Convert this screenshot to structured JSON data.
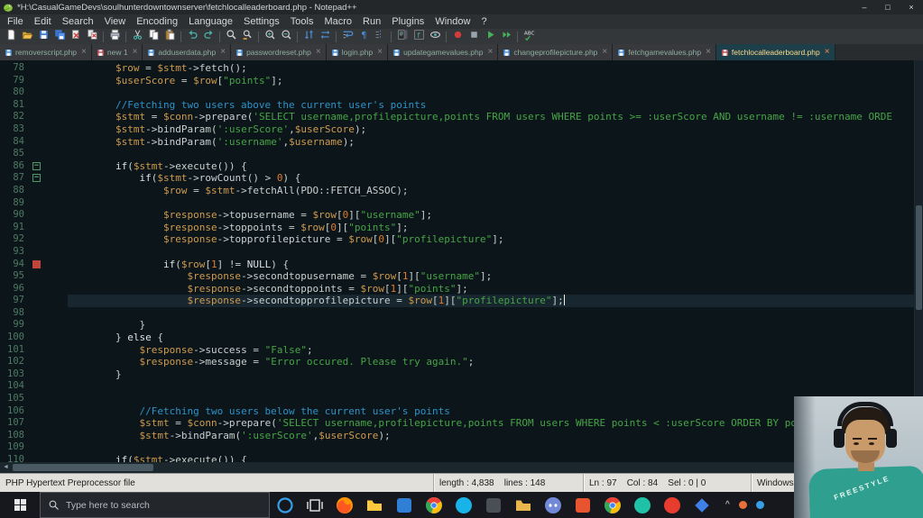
{
  "theme": {
    "titlebar_bg": "#24272a",
    "editor_bg": "#0c151a",
    "current_line_bg": "#17262f",
    "variable_color": "#cf9b4f",
    "string_color": "#46a546",
    "comment_color": "#2c93c8",
    "number_color": "#df7c2e",
    "line_number_color": "#4e7a63",
    "active_tab_text": "#ffd98c",
    "statusbar_bg": "#e2e0db",
    "taskbar_bg": "#16181d",
    "shirt_color": "#2fa090"
  },
  "window": {
    "title": "*H:\\CasualGameDevs\\soulhunterdowntownserver\\fetchlocalleaderboard.php - Notepad++",
    "minimize_glyph": "–",
    "maximize_glyph": "□",
    "close_glyph": "×"
  },
  "menu": {
    "items": [
      "File",
      "Edit",
      "Search",
      "View",
      "Encoding",
      "Language",
      "Settings",
      "Tools",
      "Macro",
      "Run",
      "Plugins",
      "Window",
      "?"
    ]
  },
  "toolbar": {
    "buttons": [
      "new-file",
      "open-file",
      "save",
      "save-all",
      "close",
      "close-all",
      "|",
      "print",
      "|",
      "cut",
      "copy",
      "paste",
      "|",
      "undo",
      "redo",
      "|",
      "find",
      "replace",
      "|",
      "zoom-in",
      "zoom-out",
      "|",
      "sync-vertical",
      "sync-horizontal",
      "|",
      "word-wrap",
      "show-all-characters",
      "indent-guide",
      "|",
      "document-map",
      "function-list",
      "monitoring",
      "|",
      "macro-record",
      "macro-stop",
      "macro-playback",
      "macro-run-multiple",
      "|",
      "spell-check"
    ]
  },
  "tabs": [
    {
      "label": "removerscript.php",
      "modified": false,
      "active": false
    },
    {
      "label": "new 1",
      "modified": true,
      "active": false
    },
    {
      "label": "adduserdata.php",
      "modified": false,
      "active": false
    },
    {
      "label": "passwordreset.php",
      "modified": false,
      "active": false
    },
    {
      "label": "login.php",
      "modified": false,
      "active": false
    },
    {
      "label": "updategamevalues.php",
      "modified": false,
      "active": false
    },
    {
      "label": "changeprofilepicture.php",
      "modified": false,
      "active": false
    },
    {
      "label": "fetchgamevalues.php",
      "modified": false,
      "active": false
    },
    {
      "label": "fetchlocalleaderboard.php",
      "modified": true,
      "active": true
    }
  ],
  "editor": {
    "current_line": 97,
    "caret_col": 84,
    "lines": [
      {
        "n": 78,
        "i": 8,
        "s": [
          [
            "var",
            "$row"
          ],
          [
            "pl",
            " = "
          ],
          [
            "var",
            "$stmt"
          ],
          [
            "pl",
            "->fetch();"
          ]
        ]
      },
      {
        "n": 79,
        "i": 8,
        "s": [
          [
            "var",
            "$userScore"
          ],
          [
            "pl",
            " = "
          ],
          [
            "var",
            "$row"
          ],
          [
            "pl",
            "["
          ],
          [
            "str",
            "\"points\""
          ],
          [
            "pl",
            "];"
          ]
        ]
      },
      {
        "n": 80,
        "i": 0,
        "s": []
      },
      {
        "n": 81,
        "i": 8,
        "s": [
          [
            "com",
            "//Fetching two users above the current user's points"
          ]
        ]
      },
      {
        "n": 82,
        "i": 8,
        "s": [
          [
            "var",
            "$stmt"
          ],
          [
            "pl",
            " = "
          ],
          [
            "var",
            "$conn"
          ],
          [
            "pl",
            "->prepare("
          ],
          [
            "str",
            "'SELECT username,profilepicture,points FROM users WHERE points >= :userScore AND username != :username ORDE"
          ]
        ]
      },
      {
        "n": 83,
        "i": 8,
        "s": [
          [
            "var",
            "$stmt"
          ],
          [
            "pl",
            "->bindParam("
          ],
          [
            "str",
            "':userScore'"
          ],
          [
            "pl",
            ","
          ],
          [
            "var",
            "$userScore"
          ],
          [
            "pl",
            ");"
          ]
        ]
      },
      {
        "n": 84,
        "i": 8,
        "s": [
          [
            "var",
            "$stmt"
          ],
          [
            "pl",
            "->bindParam("
          ],
          [
            "str",
            "':username'"
          ],
          [
            "pl",
            ","
          ],
          [
            "var",
            "$username"
          ],
          [
            "pl",
            ");"
          ]
        ]
      },
      {
        "n": 85,
        "i": 0,
        "s": []
      },
      {
        "n": 86,
        "i": 8,
        "m": "fold",
        "s": [
          [
            "kw",
            "if"
          ],
          [
            "pl",
            "("
          ],
          [
            "var",
            "$stmt"
          ],
          [
            "pl",
            "->execute()) {"
          ]
        ]
      },
      {
        "n": 87,
        "i": 12,
        "m": "fold",
        "s": [
          [
            "kw",
            "if"
          ],
          [
            "pl",
            "("
          ],
          [
            "var",
            "$stmt"
          ],
          [
            "pl",
            "->rowCount() > "
          ],
          [
            "num",
            "0"
          ],
          [
            "pl",
            ") {"
          ]
        ]
      },
      {
        "n": 88,
        "i": 16,
        "s": [
          [
            "var",
            "$row"
          ],
          [
            "pl",
            " = "
          ],
          [
            "var",
            "$stmt"
          ],
          [
            "pl",
            "->fetchAll(PDO::FETCH_ASSOC);"
          ]
        ]
      },
      {
        "n": 89,
        "i": 0,
        "s": []
      },
      {
        "n": 90,
        "i": 16,
        "s": [
          [
            "var",
            "$response"
          ],
          [
            "pl",
            "->topusername = "
          ],
          [
            "var",
            "$row"
          ],
          [
            "pl",
            "["
          ],
          [
            "num",
            "0"
          ],
          [
            "pl",
            "]["
          ],
          [
            "str",
            "\"username\""
          ],
          [
            "pl",
            "];"
          ]
        ]
      },
      {
        "n": 91,
        "i": 16,
        "s": [
          [
            "var",
            "$response"
          ],
          [
            "pl",
            "->toppoints = "
          ],
          [
            "var",
            "$row"
          ],
          [
            "pl",
            "["
          ],
          [
            "num",
            "0"
          ],
          [
            "pl",
            "]["
          ],
          [
            "str",
            "\"points\""
          ],
          [
            "pl",
            "];"
          ]
        ]
      },
      {
        "n": 92,
        "i": 16,
        "s": [
          [
            "var",
            "$response"
          ],
          [
            "pl",
            "->topprofilepicture = "
          ],
          [
            "var",
            "$row"
          ],
          [
            "pl",
            "["
          ],
          [
            "num",
            "0"
          ],
          [
            "pl",
            "]["
          ],
          [
            "str",
            "\"profilepicture\""
          ],
          [
            "pl",
            "];"
          ]
        ]
      },
      {
        "n": 93,
        "i": 0,
        "s": []
      },
      {
        "n": 94,
        "i": 16,
        "m": "red",
        "s": [
          [
            "kw",
            "if"
          ],
          [
            "pl",
            "("
          ],
          [
            "var",
            "$row"
          ],
          [
            "pl",
            "["
          ],
          [
            "num",
            "1"
          ],
          [
            "pl",
            "] != "
          ],
          [
            "kw",
            "NULL"
          ],
          [
            "pl",
            ") {"
          ]
        ]
      },
      {
        "n": 95,
        "i": 20,
        "s": [
          [
            "var",
            "$response"
          ],
          [
            "pl",
            "->secondtopusername = "
          ],
          [
            "var",
            "$row"
          ],
          [
            "pl",
            "["
          ],
          [
            "num",
            "1"
          ],
          [
            "pl",
            "]["
          ],
          [
            "str",
            "\"username\""
          ],
          [
            "pl",
            "];"
          ]
        ]
      },
      {
        "n": 96,
        "i": 20,
        "s": [
          [
            "var",
            "$response"
          ],
          [
            "pl",
            "->secondtoppoints = "
          ],
          [
            "var",
            "$row"
          ],
          [
            "pl",
            "["
          ],
          [
            "num",
            "1"
          ],
          [
            "pl",
            "]["
          ],
          [
            "str",
            "\"points\""
          ],
          [
            "pl",
            "];"
          ]
        ]
      },
      {
        "n": 97,
        "i": 20,
        "s": [
          [
            "var",
            "$response"
          ],
          [
            "pl",
            "->secondtopprofilepicture = "
          ],
          [
            "var",
            "$row"
          ],
          [
            "pl",
            "["
          ],
          [
            "num",
            "1"
          ],
          [
            "pl",
            "]["
          ],
          [
            "str",
            "\"profilepicture\""
          ],
          [
            "pl",
            "];"
          ]
        ]
      },
      {
        "n": 98,
        "i": 0,
        "s": []
      },
      {
        "n": 99,
        "i": 12,
        "s": [
          [
            "pl",
            "}"
          ]
        ]
      },
      {
        "n": 100,
        "i": 8,
        "s": [
          [
            "pl",
            "} "
          ],
          [
            "kw",
            "else"
          ],
          [
            "pl",
            " {"
          ]
        ]
      },
      {
        "n": 101,
        "i": 12,
        "s": [
          [
            "var",
            "$response"
          ],
          [
            "pl",
            "->success = "
          ],
          [
            "str",
            "\"False\""
          ],
          [
            "pl",
            ";"
          ]
        ]
      },
      {
        "n": 102,
        "i": 12,
        "s": [
          [
            "var",
            "$response"
          ],
          [
            "pl",
            "->message = "
          ],
          [
            "str",
            "\"Error occured. Please try again.\""
          ],
          [
            "pl",
            ";"
          ]
        ]
      },
      {
        "n": 103,
        "i": 8,
        "s": [
          [
            "pl",
            "}"
          ]
        ]
      },
      {
        "n": 104,
        "i": 0,
        "s": []
      },
      {
        "n": 105,
        "i": 0,
        "s": []
      },
      {
        "n": 106,
        "i": 12,
        "s": [
          [
            "com",
            "//Fetching two users below the current user's points"
          ]
        ]
      },
      {
        "n": 107,
        "i": 12,
        "s": [
          [
            "var",
            "$stmt"
          ],
          [
            "pl",
            " = "
          ],
          [
            "var",
            "$conn"
          ],
          [
            "pl",
            "->prepare("
          ],
          [
            "str",
            "'SELECT username,profilepicture,points FROM users WHERE points < :userScore ORDER BY poin"
          ]
        ]
      },
      {
        "n": 108,
        "i": 12,
        "s": [
          [
            "var",
            "$stmt"
          ],
          [
            "pl",
            "->bindParam("
          ],
          [
            "str",
            "':userScore'"
          ],
          [
            "pl",
            ","
          ],
          [
            "var",
            "$userScore"
          ],
          [
            "pl",
            ");"
          ]
        ]
      },
      {
        "n": 109,
        "i": 0,
        "s": []
      },
      {
        "n": 110,
        "i": 8,
        "s": [
          [
            "kw",
            "if"
          ],
          [
            "pl",
            "("
          ],
          [
            "var",
            "$stmt"
          ],
          [
            "pl",
            "->execute()) {"
          ]
        ]
      }
    ]
  },
  "status_bar": {
    "doc_type": "PHP Hypertext Preprocessor file",
    "length_lines": "length : 4,838    lines : 148",
    "cursor_position": "Ln : 97    Col : 84    Sel : 0 | 0",
    "eol_format": "Windows (CR LF)"
  },
  "taskbar": {
    "search_placeholder": "Type here to search",
    "apps": [
      {
        "name": "cortana",
        "shape": "ring",
        "color": "#35a0e8"
      },
      {
        "name": "task-view",
        "shape": "taskview",
        "color": "#e8e8e8"
      },
      {
        "name": "firefox",
        "shape": "firefox",
        "color": "#ff9500"
      },
      {
        "name": "file-explorer",
        "shape": "folder",
        "color": "#ffc83d"
      },
      {
        "name": "blue-app",
        "shape": "square",
        "color": "#2f7fd6"
      },
      {
        "name": "chrome",
        "shape": "chrome",
        "color": "#4285f4"
      },
      {
        "name": "teal-app-1",
        "shape": "circle",
        "color": "#18b3e8"
      },
      {
        "name": "dark-app-1",
        "shape": "square",
        "color": "#4a4f55"
      },
      {
        "name": "folder-app",
        "shape": "folder",
        "color": "#e8b64c"
      },
      {
        "name": "discord",
        "shape": "discord",
        "color": "#7289da"
      },
      {
        "name": "orange-app",
        "shape": "square",
        "color": "#e8542f"
      },
      {
        "name": "chrome-2",
        "shape": "chrome",
        "color": "#4285f4"
      },
      {
        "name": "teal-app-2",
        "shape": "circle",
        "color": "#1fc2a7"
      },
      {
        "name": "red-app",
        "shape": "circle",
        "color": "#e83c2f"
      },
      {
        "name": "blue-diamond-app",
        "shape": "diamond",
        "color": "#3f7fe8"
      }
    ],
    "tray": [
      {
        "name": "hidden-icons-chevron",
        "glyph": "^"
      },
      {
        "name": "tray-icon-1",
        "color": "#e8703a"
      },
      {
        "name": "tray-icon-2",
        "color": "#35a0e8"
      }
    ]
  },
  "webcam": {
    "shirt_text": "FREESTYLE"
  }
}
